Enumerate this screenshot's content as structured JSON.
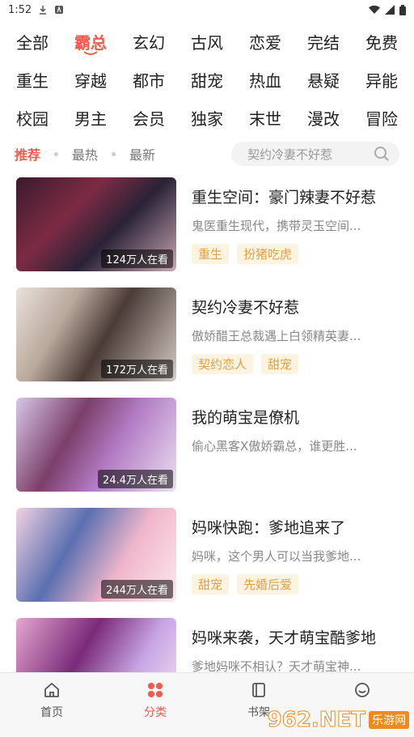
{
  "status": {
    "time": "1:52"
  },
  "categories": [
    {
      "label": "全部"
    },
    {
      "label": "霸总"
    },
    {
      "label": "玄幻"
    },
    {
      "label": "古风"
    },
    {
      "label": "恋爱"
    },
    {
      "label": "完结"
    },
    {
      "label": "免费"
    },
    {
      "label": "重生"
    },
    {
      "label": "穿越"
    },
    {
      "label": "都市"
    },
    {
      "label": "甜宠"
    },
    {
      "label": "热血"
    },
    {
      "label": "悬疑"
    },
    {
      "label": "异能"
    },
    {
      "label": "校园"
    },
    {
      "label": "男主"
    },
    {
      "label": "会员"
    },
    {
      "label": "独家"
    },
    {
      "label": "末世"
    },
    {
      "label": "漫改"
    },
    {
      "label": "冒险"
    }
  ],
  "active_category": "霸总",
  "sort": {
    "recommend": "推荐",
    "hot": "最热",
    "newest": "最新"
  },
  "search": {
    "placeholder": "契约冷妻不好惹"
  },
  "comics": [
    {
      "title": "重生空间：豪门辣妻不好惹",
      "desc": "鬼医重生现代，携带灵玉空间...",
      "views": "124万人在看",
      "tags": [
        "重生",
        "扮猪吃虎"
      ]
    },
    {
      "title": "契约冷妻不好惹",
      "desc": "傲娇醋王总裁遇上白领精英妻...",
      "views": "172万人在看",
      "tags": [
        "契约恋人",
        "甜宠"
      ]
    },
    {
      "title": "我的萌宝是僚机",
      "desc": "偷心黑客X傲娇霸总，谁更胜...",
      "views": "24.4万人在看",
      "tags": []
    },
    {
      "title": "妈咪快跑：爹地追来了",
      "desc": "妈咪，这个男人可以当我爹地...",
      "views": "244万人在看",
      "tags": [
        "甜宠",
        "先婚后爱"
      ]
    },
    {
      "title": "妈咪来袭，天才萌宝酷爹地",
      "desc": "爹地妈咪不相认？天才萌宝神...",
      "views": "",
      "tags": []
    }
  ],
  "tabs": {
    "home": "首页",
    "category": "分类",
    "shelf": "书架",
    "mine": "我的"
  },
  "watermark": {
    "num": "962.NET",
    "text": "乐游网"
  },
  "colors": {
    "accent": "#ef5b4c",
    "tag_bg": "#fdf3e1",
    "tag_fg": "#e0a14a"
  }
}
